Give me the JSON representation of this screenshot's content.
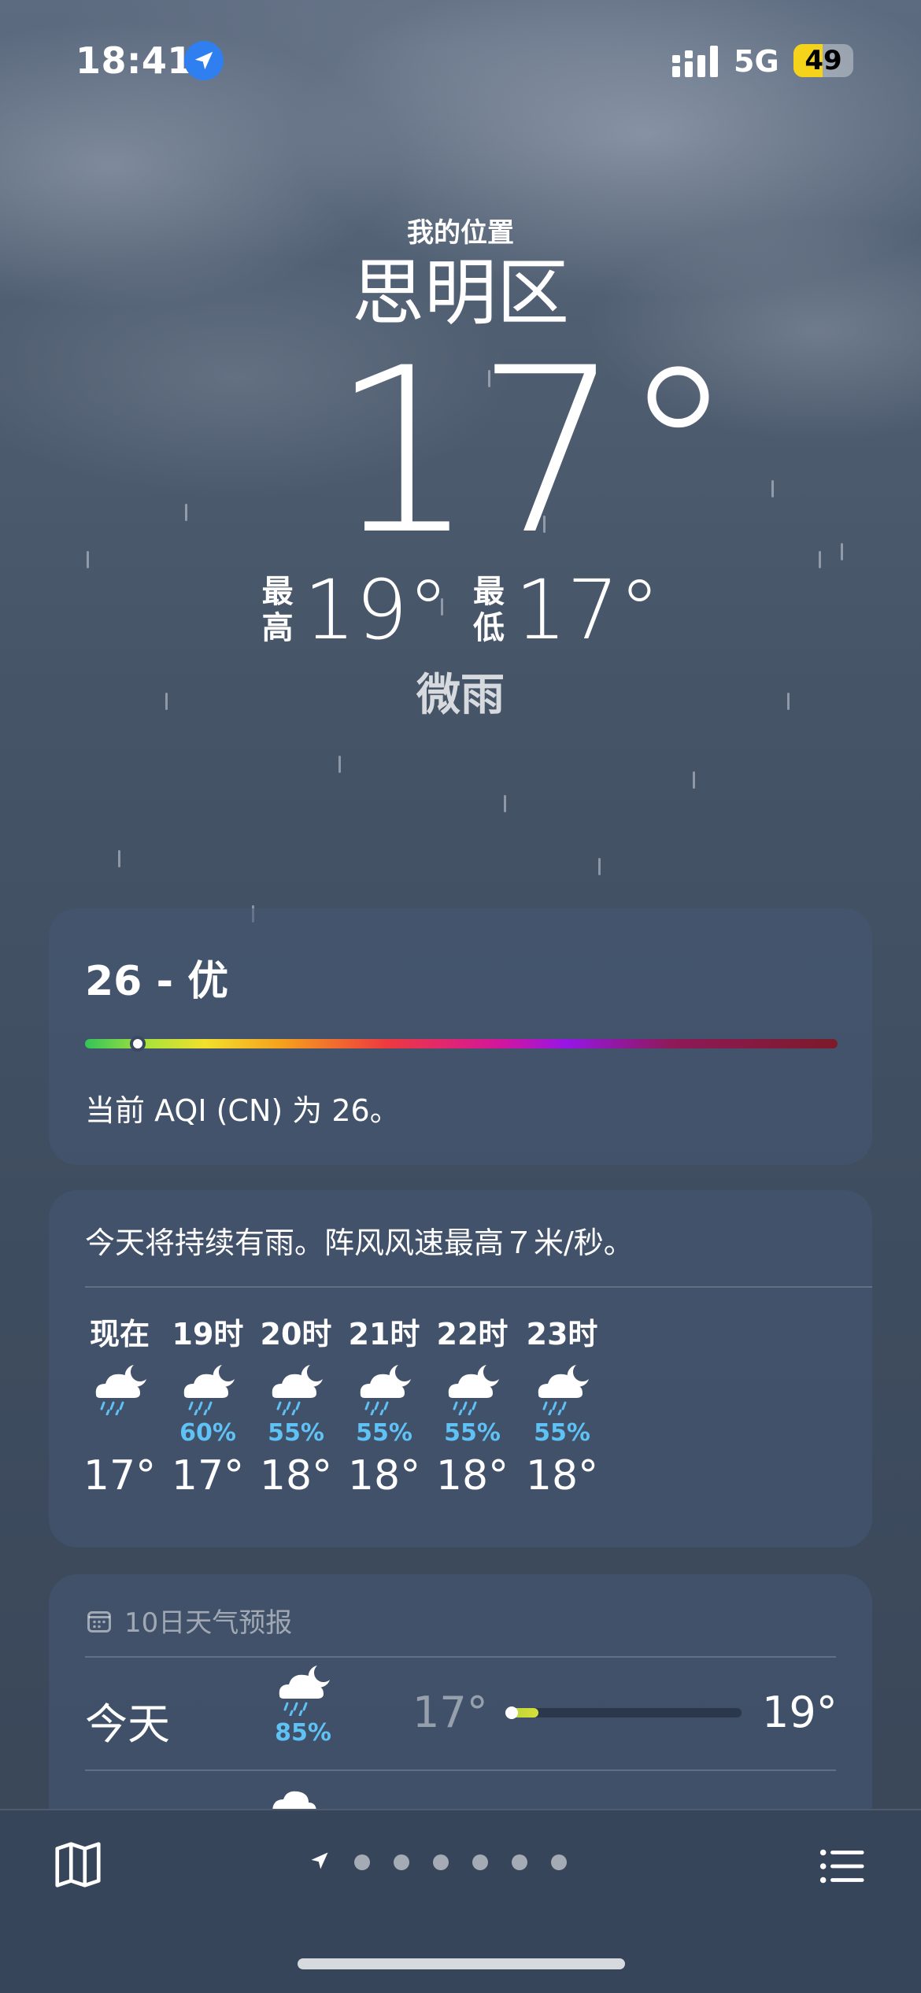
{
  "status_bar": {
    "time": "18:41",
    "network": "5G",
    "battery_percent": "49",
    "battery_level": 0.49,
    "battery_color": "#f5d31a",
    "icons": [
      "location-arrow-icon",
      "signal-icon",
      "battery-icon"
    ]
  },
  "header": {
    "my_location": "我的位置",
    "city": "思明区",
    "temperature": "17°",
    "high_label": "最高",
    "high": "19°",
    "low_label": "最低",
    "low": "17°",
    "condition": "微雨"
  },
  "aqi": {
    "title": "26 - 优",
    "value": 26,
    "level_fraction": 0.06,
    "description": "当前 AQI (CN) 为 26。"
  },
  "hourly": {
    "summary": "今天将持续有雨。阵风风速最高７米/秒。",
    "items": [
      {
        "label": "现在",
        "icon": "cloud-moon-rain-icon",
        "pop": "",
        "temp": "17°"
      },
      {
        "label": "19时",
        "icon": "cloud-moon-rain-icon",
        "pop": "60%",
        "temp": "17°"
      },
      {
        "label": "20时",
        "icon": "cloud-moon-rain-icon",
        "pop": "55%",
        "temp": "18°"
      },
      {
        "label": "21时",
        "icon": "cloud-moon-rain-icon",
        "pop": "55%",
        "temp": "18°"
      },
      {
        "label": "22时",
        "icon": "cloud-moon-rain-icon",
        "pop": "55%",
        "temp": "18°"
      },
      {
        "label": "23时",
        "icon": "cloud-moon-rain-icon",
        "pop": "55%",
        "temp": "18°"
      }
    ],
    "pop_color": "#5ec2f5"
  },
  "daily": {
    "header": "10日天气预报",
    "header_icon": "calendar-icon",
    "items": [
      {
        "day": "今天",
        "icon": "cloud-moon-rain-icon",
        "pop": "85%",
        "low": "17°",
        "high": "19°",
        "range_start": 0.0,
        "range_end": 0.14,
        "current": 0.0
      }
    ]
  },
  "bottom_bar": {
    "map_icon": "map-icon",
    "list_icon": "list-icon",
    "page_count": 7,
    "current_page": 0
  }
}
